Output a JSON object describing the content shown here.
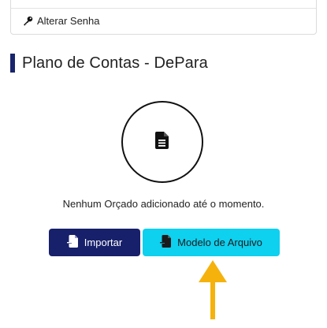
{
  "menu": {
    "change_password_label": "Alterar Senha",
    "change_password_icon": "key-icon"
  },
  "section": {
    "title": "Plano de Contas - DePara",
    "accent_color": "#18246b"
  },
  "empty_state": {
    "icon": "file-icon",
    "message": "Nenhum Orçado adicionado até o momento."
  },
  "actions": {
    "import_label": "Importar",
    "import_icon": "file-import-icon",
    "import_color": "#17206a",
    "model_label": "Modelo de Arquivo",
    "model_icon": "file-import-icon",
    "model_color": "#0ed0ef"
  },
  "annotation": {
    "arrow_color": "#f5b20c",
    "arrow_icon": "arrow-up-icon"
  }
}
